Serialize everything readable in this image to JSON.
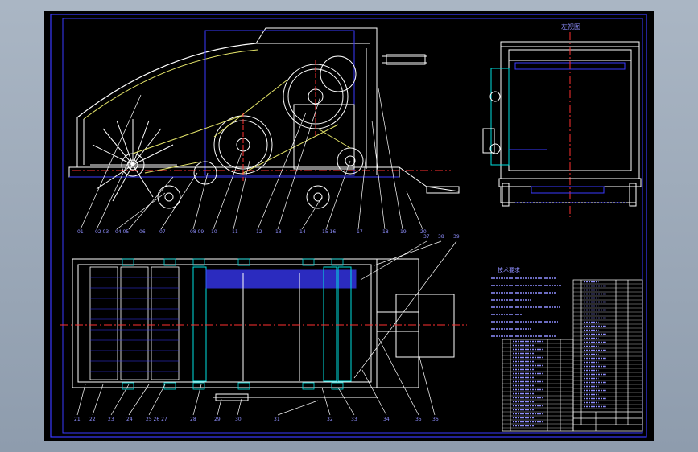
{
  "title_block_label": "技术要求",
  "side_view_label": "左视图",
  "colors": {
    "background": "#000000",
    "frame": "#3a3aff",
    "lines": "#ffffff",
    "accent_yellow": "#e6e66a",
    "accent_cyan": "#00e0e0",
    "accent_red": "#ff3030"
  }
}
